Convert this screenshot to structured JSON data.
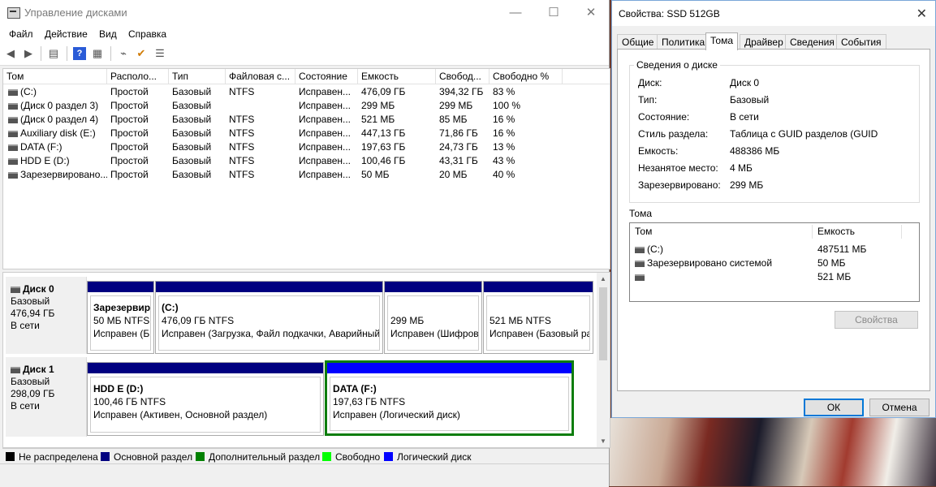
{
  "window": {
    "title": "Управление дисками",
    "minimize": "—",
    "maximize": "☐",
    "close": "✕"
  },
  "menu": [
    "Файл",
    "Действие",
    "Вид",
    "Справка"
  ],
  "volume_table": {
    "columns": [
      "Том",
      "Располо...",
      "Тип",
      "Файловая с...",
      "Состояние",
      "Емкость",
      "Свобод...",
      "Свободно %"
    ],
    "rows": [
      [
        "(C:)",
        "Простой",
        "Базовый",
        "NTFS",
        "Исправен...",
        "476,09 ГБ",
        "394,32 ГБ",
        "83 %"
      ],
      [
        "(Диск 0 раздел 3)",
        "Простой",
        "Базовый",
        "",
        "Исправен...",
        "299 МБ",
        "299 МБ",
        "100 %"
      ],
      [
        "(Диск 0 раздел 4)",
        "Простой",
        "Базовый",
        "NTFS",
        "Исправен...",
        "521 МБ",
        "85 МБ",
        "16 %"
      ],
      [
        "Auxiliary disk (E:)",
        "Простой",
        "Базовый",
        "NTFS",
        "Исправен...",
        "447,13 ГБ",
        "71,86 ГБ",
        "16 %"
      ],
      [
        "DATA (F:)",
        "Простой",
        "Базовый",
        "NTFS",
        "Исправен...",
        "197,63 ГБ",
        "24,73 ГБ",
        "13 %"
      ],
      [
        "HDD E (D:)",
        "Простой",
        "Базовый",
        "NTFS",
        "Исправен...",
        "100,46 ГБ",
        "43,31 ГБ",
        "43 %"
      ],
      [
        "Зарезервировано...",
        "Простой",
        "Базовый",
        "NTFS",
        "Исправен...",
        "50 МБ",
        "20 МБ",
        "40 %"
      ]
    ]
  },
  "disks": [
    {
      "name": "Диск 0",
      "type": "Базовый",
      "size": "476,94 ГБ",
      "status": "В сети",
      "partitions": [
        {
          "name": "Зарезервир",
          "size": "50 МБ NTFS",
          "status": "Исправен (Б"
        },
        {
          "name": "(C:)",
          "size": "476,09 ГБ NTFS",
          "status": "Исправен (Загрузка, Файл подкачки, Аварийный"
        },
        {
          "name": "",
          "size": "299 МБ",
          "status": "Исправен (Шифров"
        },
        {
          "name": "",
          "size": "521 МБ NTFS",
          "status": "Исправен (Базовый ра"
        }
      ]
    },
    {
      "name": "Диск 1",
      "type": "Базовый",
      "size": "298,09 ГБ",
      "status": "В сети",
      "partitions": [
        {
          "name": "HDD E  (D:)",
          "size": "100,46 ГБ NTFS",
          "status": "Исправен (Активен, Основной раздел)"
        },
        {
          "name": "DATA  (F:)",
          "size": "197,63 ГБ NTFS",
          "status": "Исправен (Логический диск)"
        }
      ]
    }
  ],
  "legend": [
    {
      "label": "Не распределена",
      "color": "#000000"
    },
    {
      "label": "Основной раздел",
      "color": "#000080"
    },
    {
      "label": "Дополнительный раздел",
      "color": "#008000"
    },
    {
      "label": "Свободно",
      "color": "#00ff00"
    },
    {
      "label": "Логический диск",
      "color": "#0000ff"
    }
  ],
  "dialog": {
    "title": "Свойства: SSD 512GB",
    "close": "✕",
    "tabs": [
      "Общие",
      "Политика",
      "Тома",
      "Драйвер",
      "Сведения",
      "События"
    ],
    "active_tab": "Тома",
    "info_group": "Сведения о диске",
    "info": [
      {
        "k": "Диск:",
        "v": "Диск 0"
      },
      {
        "k": "Тип:",
        "v": "Базовый"
      },
      {
        "k": "Состояние:",
        "v": "В сети"
      },
      {
        "k": "Стиль раздела:",
        "v": "Таблица с GUID разделов (GUID"
      },
      {
        "k": "Емкость:",
        "v": "488386 МБ"
      },
      {
        "k": "Незанятое место:",
        "v": "4 МБ"
      },
      {
        "k": "Зарезервировано:",
        "v": "299 МБ"
      }
    ],
    "volumes_label": "Тома",
    "volumes_columns": [
      "Том",
      "Емкость"
    ],
    "volumes": [
      {
        "name": "(C:)",
        "cap": "487511 МБ"
      },
      {
        "name": "Зарезервировано системой",
        "cap": "50 МБ"
      },
      {
        "name": "",
        "cap": "521 МБ"
      }
    ],
    "props_button": "Свойства",
    "ok_button": "ОК",
    "cancel_button": "Отмена"
  }
}
